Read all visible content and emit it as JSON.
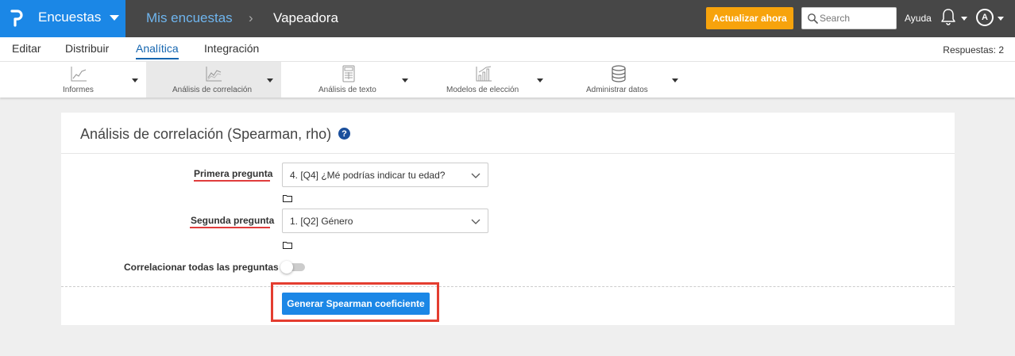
{
  "brand": {
    "title": "Encuestas",
    "logo_icon": "p-logo-icon"
  },
  "breadcrumb": {
    "parent": "Mis encuestas",
    "separator": "›",
    "current": "Vapeadora"
  },
  "header": {
    "upgrade_label": "Actualizar ahora",
    "search_placeholder": "Search",
    "search_value": "",
    "help_label": "Ayuda",
    "avatar_initial": "A"
  },
  "nav": {
    "tabs": [
      {
        "label": "Editar"
      },
      {
        "label": "Distribuir"
      },
      {
        "label": "Analítica",
        "active": true
      },
      {
        "label": "Integración"
      }
    ],
    "responses_label": "Respuestas: 2"
  },
  "toolbar": {
    "items": [
      {
        "label": "Informes",
        "icon": "line-chart-icon"
      },
      {
        "label": "Análisis de correlación",
        "icon": "correlation-chart-icon",
        "active": true
      },
      {
        "label": "Análisis de texto",
        "icon": "text-analysis-icon"
      },
      {
        "label": "Modelos de elección",
        "icon": "choice-model-icon"
      },
      {
        "label": "Administrar datos",
        "icon": "database-icon"
      }
    ]
  },
  "panel": {
    "title": "Análisis de correlación (Spearman, rho)",
    "help_icon": "?",
    "first_question_label": "Primera pregunta",
    "first_question_value": "4. [Q4] ¿Mé podrías indicar tu edad?",
    "second_question_label": "Segunda pregunta",
    "second_question_value": "1. [Q2] Género",
    "correlate_all_label": "Correlacionar todas las preguntas",
    "correlate_all_enabled": false,
    "generate_button_label": "Generar Spearman coeficiente"
  },
  "colors": {
    "brand_blue": "#1b87e6",
    "topbar": "#474747",
    "upgrade_orange": "#f7a30c",
    "highlight_red": "#e43d30",
    "active_tab": "#1566b0"
  }
}
